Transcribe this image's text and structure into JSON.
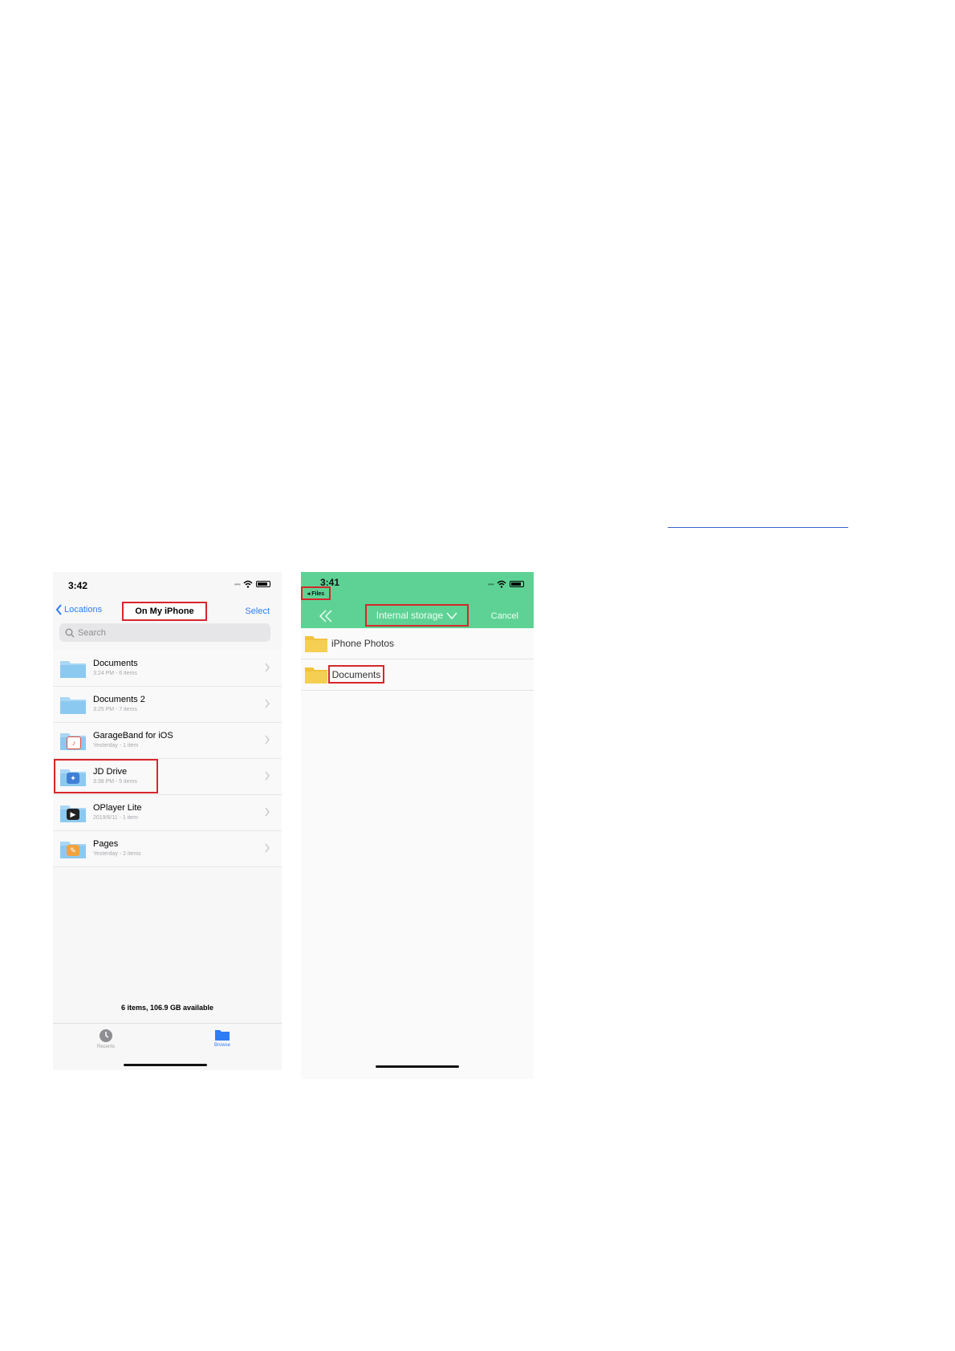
{
  "left_phone": {
    "status_time": "3:42",
    "back_label": "Locations",
    "title": "On My iPhone",
    "select_label": "Select",
    "search_placeholder": "Search",
    "rows": [
      {
        "name": "Documents",
        "meta": "3:24 PM - 6 items"
      },
      {
        "name": "Documents 2",
        "meta": "3:25 PM - 7 items"
      },
      {
        "name": "GarageBand for iOS",
        "meta": "Yesterday - 1 item"
      },
      {
        "name": "JD Drive",
        "meta": "3:38 PM - 5 items"
      },
      {
        "name": "OPlayer Lite",
        "meta": "2019/6/11 - 1 item"
      },
      {
        "name": "Pages",
        "meta": "Yesterday - 2 items"
      }
    ],
    "footer": "6 items, 106.9 GB available",
    "tabs": {
      "recents": "Recents",
      "browse": "Browse"
    },
    "accent_color": "#2f7cf6",
    "highlight_color": "#d8262b"
  },
  "right_phone": {
    "status_time": "3:41",
    "files_back": "◂ Files",
    "storage_label": "Internal storage",
    "cancel_label": "Cancel",
    "rows": [
      {
        "name": "iPhone Photos"
      },
      {
        "name": "Documents"
      }
    ],
    "header_color": "#5ed294"
  }
}
